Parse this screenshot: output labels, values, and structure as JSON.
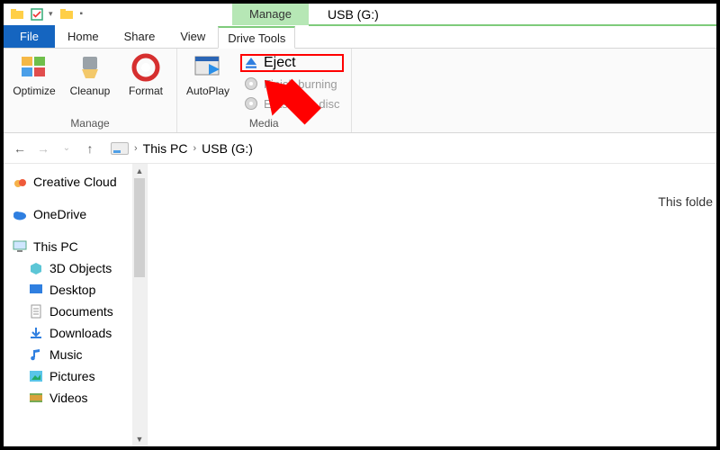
{
  "window": {
    "title": "USB (G:)",
    "context_tab": "Manage"
  },
  "tabs": {
    "file": "File",
    "home": "Home",
    "share": "Share",
    "view": "View",
    "drive_tools": "Drive Tools"
  },
  "ribbon": {
    "manage": {
      "label": "Manage",
      "optimize": "Optimize",
      "cleanup": "Cleanup",
      "format": "Format"
    },
    "media": {
      "label": "Media",
      "autoplay": "AutoPlay",
      "eject": "Eject",
      "finish_burning": "Finish burning",
      "erase_this_disc": "Erase this disc"
    }
  },
  "breadcrumb": {
    "this_pc": "This PC",
    "drive": "USB (G:)"
  },
  "navpane": {
    "creative_cloud": "Creative Cloud",
    "onedrive": "OneDrive",
    "this_pc": "This PC",
    "objects3d": "3D Objects",
    "desktop": "Desktop",
    "documents": "Documents",
    "downloads": "Downloads",
    "music": "Music",
    "pictures": "Pictures",
    "videos": "Videos"
  },
  "content": {
    "empty_hint": "This folde"
  }
}
